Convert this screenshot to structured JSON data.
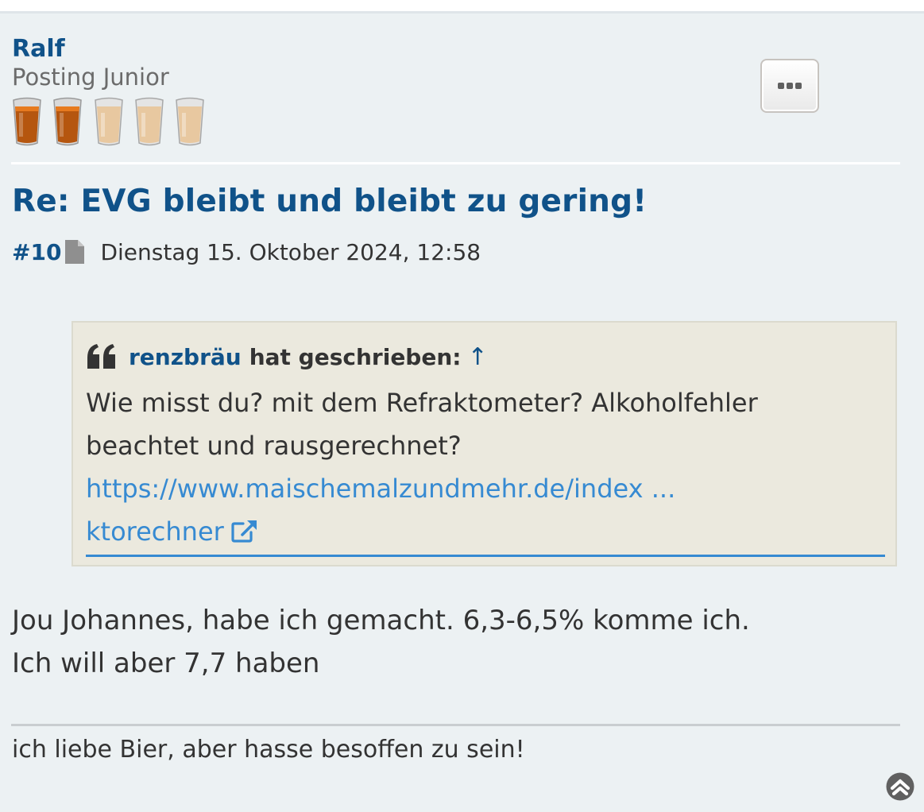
{
  "user": {
    "name": "Ralf",
    "rank": "Posting Junior",
    "rank_glasses": {
      "filled": 2,
      "total": 5
    }
  },
  "post": {
    "title": "Re: EVG bleibt und bleibt zu gering!",
    "number": "#10",
    "date": "Dienstag 15. Oktober 2024, 12:58",
    "quote": {
      "author": "renzbräu",
      "wrote_label": "hat geschrieben:",
      "arrow": "↑",
      "text_line1": "Wie misst du? mit dem Refraktometer? Alkoholfehler",
      "text_line2": "beachtet und rausgerechnet?",
      "link_line1": "https://www.maischemalzundmehr.de/index ...",
      "link_line2": "ktorechner"
    },
    "body_line1": "Jou Johannes, habe ich gemacht. 6,3-6,5% komme ich.",
    "body_line2": "Ich will aber 7,7 haben",
    "signature": "ich liebe Bier, aber hasse besoffen zu sein!"
  },
  "icons": {
    "menu": "ellipsis-icon",
    "post_link": "file-icon",
    "quote": "quote-icon",
    "external": "external-link-icon",
    "back_to_top": "chevron-up-circle-icon"
  },
  "colors": {
    "post_bg": "#ECF1F3",
    "link_blue": "#105289",
    "quote_bg": "#EBE9DE",
    "url_blue": "#368AD2",
    "beer_full": "#B5560F",
    "beer_empty": "#E8C8A0"
  }
}
